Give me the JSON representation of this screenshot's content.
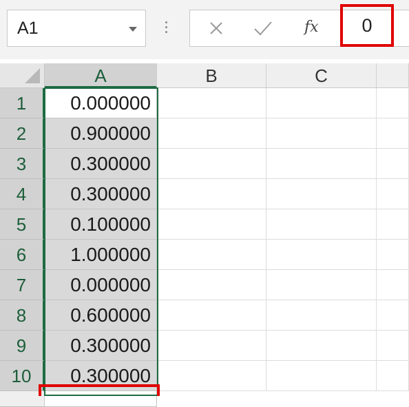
{
  "name_box": {
    "value": "A1"
  },
  "formula_bar": {
    "cancel_icon": "close-icon",
    "enter_icon": "check-icon",
    "function_label": "fx",
    "value": "0"
  },
  "columns": [
    "A",
    "B",
    "C"
  ],
  "selected_column": "A",
  "rows": [
    {
      "num": "1",
      "a": "0.000000"
    },
    {
      "num": "2",
      "a": "0.900000"
    },
    {
      "num": "3",
      "a": "0.300000"
    },
    {
      "num": "4",
      "a": "0.300000"
    },
    {
      "num": "5",
      "a": "0.100000"
    },
    {
      "num": "6",
      "a": "1.000000"
    },
    {
      "num": "7",
      "a": "0.000000"
    },
    {
      "num": "8",
      "a": "0.600000"
    },
    {
      "num": "9",
      "a": "0.300000"
    },
    {
      "num": "10",
      "a": "0.300000"
    }
  ],
  "colors": {
    "accent": "#1d6b42",
    "highlight": "#e00000"
  }
}
